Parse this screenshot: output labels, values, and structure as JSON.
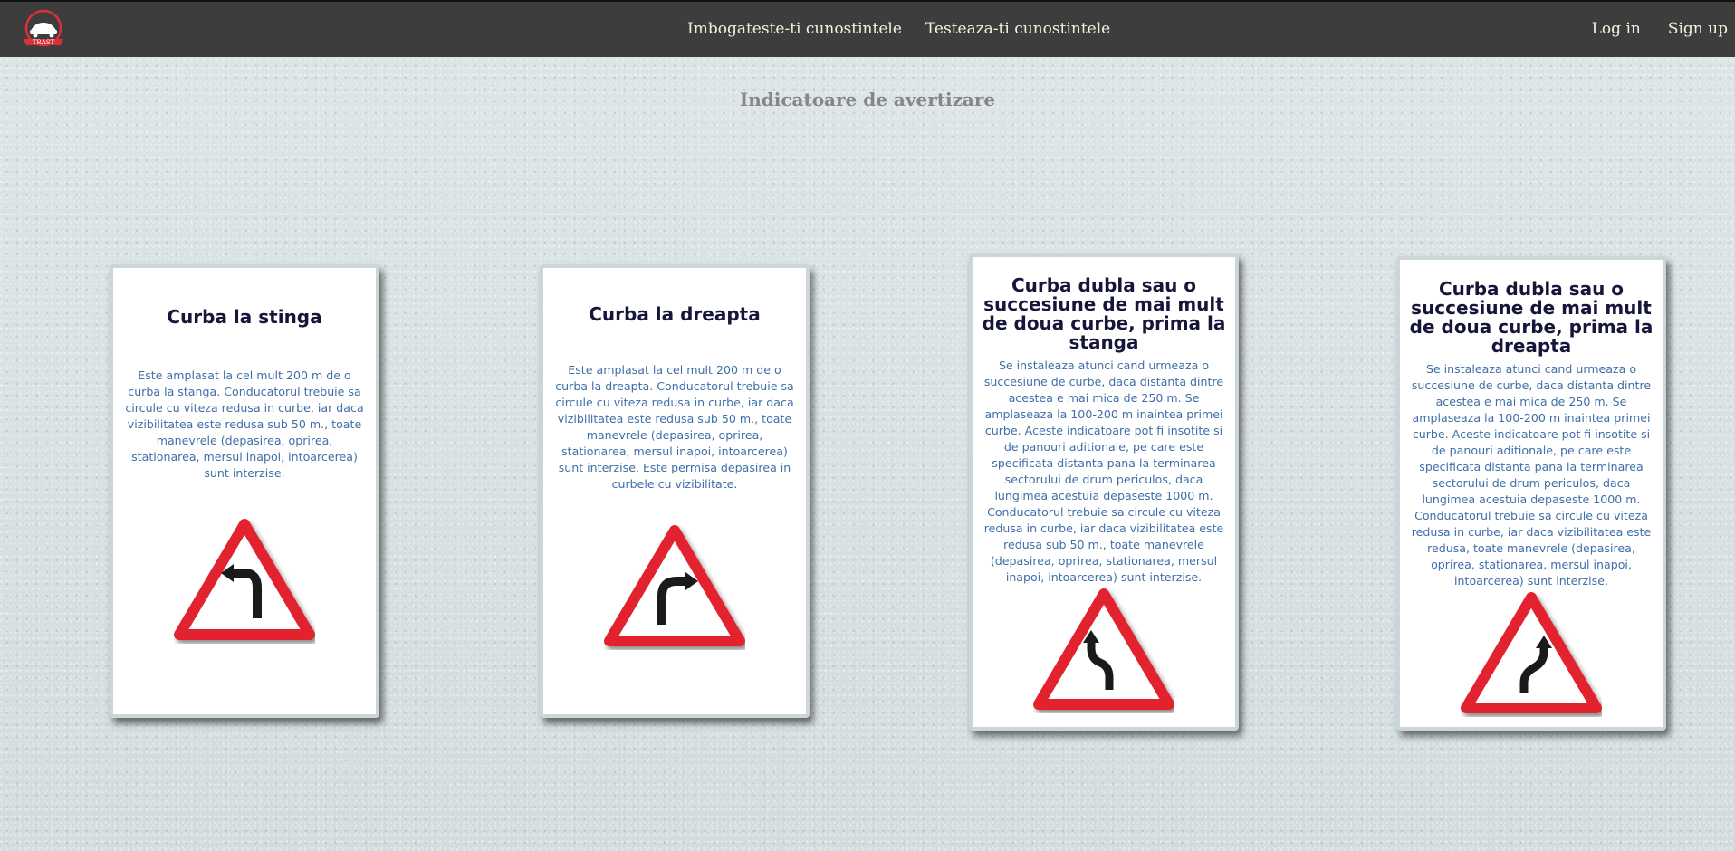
{
  "navbar": {
    "logo_text": "TRAST",
    "links": [
      "Imbogateste-ti cunostintele",
      "Testeaza-ti cunostintele"
    ],
    "login": "Log in",
    "signup": "Sign up"
  },
  "page_title": "Indicatoare de avertizare",
  "cards": [
    {
      "title": "Curba la stinga",
      "text": "Este amplasat la cel mult 200 m de o curba la stanga. Conducatorul trebuie sa circule cu viteza redusa in curbe, iar daca vizibilitatea este redusa sub 50 m., toate manevrele (depasirea, oprirea, stationarea, mersul inapoi, intoarcerea) sunt interzise.",
      "sign": "curve-left-sign-icon"
    },
    {
      "title": "Curba la dreapta",
      "text": "Este amplasat la cel mult 200 m de o curba la dreapta. Conducatorul trebuie sa circule cu viteza redusa in curbe, iar daca vizibilitatea este redusa sub 50 m., toate manevrele (depasirea, oprirea, stationarea, mersul inapoi, intoarcerea) sunt interzise. Este permisa depasirea in curbele cu vizibilitate.",
      "sign": "curve-right-sign-icon"
    },
    {
      "title": "Curba dubla sau o succesiune de mai mult de doua curbe, prima la stanga",
      "text": "Se instaleaza atunci cand urmeaza o succesiune de curbe, daca distanta dintre acestea e mai mica de 250 m. Se amplaseaza la 100-200 m inaintea primei curbe. Aceste indicatoare pot fi insotite si de panouri aditionale, pe care este specificata distanta pana la terminarea sectorului de drum periculos, daca lungimea acestuia depaseste 1000 m. Conducatorul trebuie sa circule cu viteza redusa in curbe, iar daca vizibilitatea este redusa sub 50 m., toate manevrele (depasirea, oprirea, stationarea, mersul inapoi, intoarcerea) sunt interzise.",
      "sign": "double-curve-left-sign-icon"
    },
    {
      "title": "Curba dubla sau o succesiune de mai mult de doua curbe, prima la dreapta",
      "text": "Se instaleaza atunci cand urmeaza o succesiune de curbe, daca distanta dintre acestea e mai mica de 250 m. Se amplaseaza la 100-200 m inaintea primei curbe. Aceste indicatoare pot fi insotite si de panouri aditionale, pe care este specificata distanta pana la terminarea sectorului de drum periculos, daca lungimea acestuia depaseste 1000 m. Conducatorul trebuie sa circule cu viteza redusa in curbe, iar daca vizibilitatea este redusa, toate manevrele (depasirea, oprirea, stationarea, mersul inapoi, intoarcerea) sunt interzise.",
      "sign": "double-curve-right-sign-icon"
    }
  ],
  "colors": {
    "navbar": "#3d3d3d",
    "nav_text": "#f5f0dc",
    "card_title": "#16163a",
    "card_text": "#3f6fa8",
    "sign_red": "#e2202e"
  }
}
